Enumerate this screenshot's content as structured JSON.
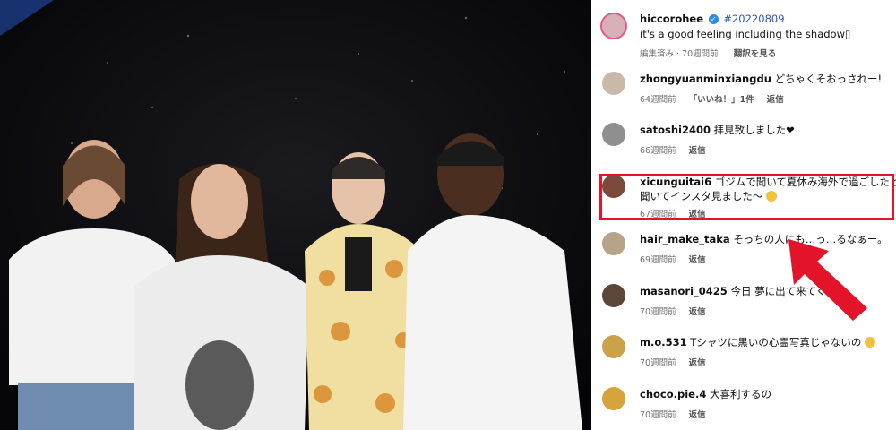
{
  "post": {
    "username": "hiccorohee",
    "hashtag": "#20220809",
    "caption": "it's a good feeling including the shadow▯",
    "edited": "編集済み · 70週間前",
    "translate": "翻訳を見る"
  },
  "comments": [
    {
      "user": "zhongyuanminxiangdu",
      "text": "どちゃくそおっされー!",
      "text2": "",
      "time": "64週間前",
      "likes": "「いいね！」1件",
      "reply": "返信",
      "avatar_color": "#c9b9a8",
      "emoji": false
    },
    {
      "user": "satoshi2400",
      "text": "拝見致しました❤",
      "text2": "",
      "time": "66週間前",
      "likes": "",
      "reply": "返信",
      "avatar_color": "#8f8f8f",
      "emoji": false
    },
    {
      "user": "xicunguitai6",
      "text": "ゴジムで聞いて夏休み海外で過ごしたと",
      "text2": "聞いてインスタ見ました〜",
      "time": "67週間前",
      "likes": "",
      "reply": "返信",
      "avatar_color": "#7a4a3a",
      "emoji": true
    },
    {
      "user": "hair_make_taka",
      "text": "そっちの人にも…っ…るなぁー。",
      "text2": "",
      "time": "69週間前",
      "likes": "",
      "reply": "返信",
      "avatar_color": "#b7a28a",
      "emoji": false
    },
    {
      "user": "masanori_0425",
      "text": "今日 夢に出て来てくれ…",
      "text2": "",
      "time": "70週間前",
      "likes": "",
      "reply": "返信",
      "avatar_color": "#5b4638",
      "emoji": false
    },
    {
      "user": "m.o.531",
      "text": "Tシャツに黒いの心霊写真じゃないの",
      "text2": "",
      "time": "70週間前",
      "likes": "",
      "reply": "返信",
      "avatar_color": "#c9a24a",
      "emoji": true
    },
    {
      "user": "choco.pie.4",
      "text": "大喜利するの",
      "text2": "",
      "time": "70週間前",
      "likes": "",
      "reply": "返信",
      "avatar_color": "#d6a43c",
      "emoji": false
    }
  ],
  "colors": {
    "highlight": "#e3132a",
    "arrow": "#e3132a",
    "verified": "#2b8be8"
  },
  "icons": {
    "verified": "verified-badge-icon",
    "arrow": "red-arrow-icon",
    "heart": "heart-emoji"
  }
}
